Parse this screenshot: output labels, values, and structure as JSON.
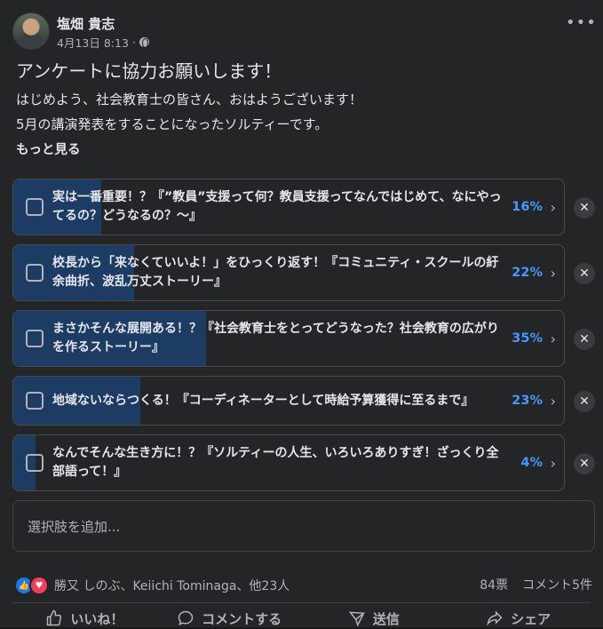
{
  "post": {
    "author": "塩畑 貴志",
    "timestamp": "4月13日 8:13",
    "title": "アンケートに協力お願いします！",
    "line1": "はじめよう、社会教育士の皆さん、おはようございます！",
    "line2": "5月の講演発表をすることになったソルティーです。",
    "see_more": "もっと見る"
  },
  "poll": {
    "options": [
      {
        "text": "実は一番重要！？『”教員”支援って何？教員支援ってなんではじめて、なにやってるの？どうなるの？〜』",
        "percent_label": "16%",
        "percent": 16
      },
      {
        "text": "校長から「来なくていいよ！」をひっくり返す！『コミュニティ・スクールの紆余曲折、波乱万丈ストーリー』",
        "percent_label": "22%",
        "percent": 22
      },
      {
        "text": "まさかそんな展開ある！？『社会教育士をとってどうなった？社会教育の広がりを作るストーリー』",
        "percent_label": "35%",
        "percent": 35
      },
      {
        "text": "地域ないならつくる！『コーディネーターとして時給予算獲得に至るまで』",
        "percent_label": "23%",
        "percent": 23
      },
      {
        "text": "なんでそんな生き方に！？『ソルティーの人生、いろいろありすぎ！ざっくり全部語って！』",
        "percent_label": "4%",
        "percent": 4
      }
    ],
    "add_option_placeholder": "選択肢を追加..."
  },
  "footer": {
    "reaction_names": "勝又 しのぶ、Keiichi Tominaga、他23人",
    "votes": "84票",
    "comments": "コメント5件",
    "like_label": "いいね！",
    "comment_label": "コメントする",
    "send_label": "送信",
    "share_label": "シェア"
  },
  "icons": {
    "more": "more-dots-icon",
    "privacy": "globe-icon",
    "reaction_like": "thumbs-up-icon",
    "reaction_love": "heart-icon"
  },
  "colors": {
    "background": "#242526",
    "poll_fill": "#1c3c63",
    "percent": "#4599ff"
  }
}
